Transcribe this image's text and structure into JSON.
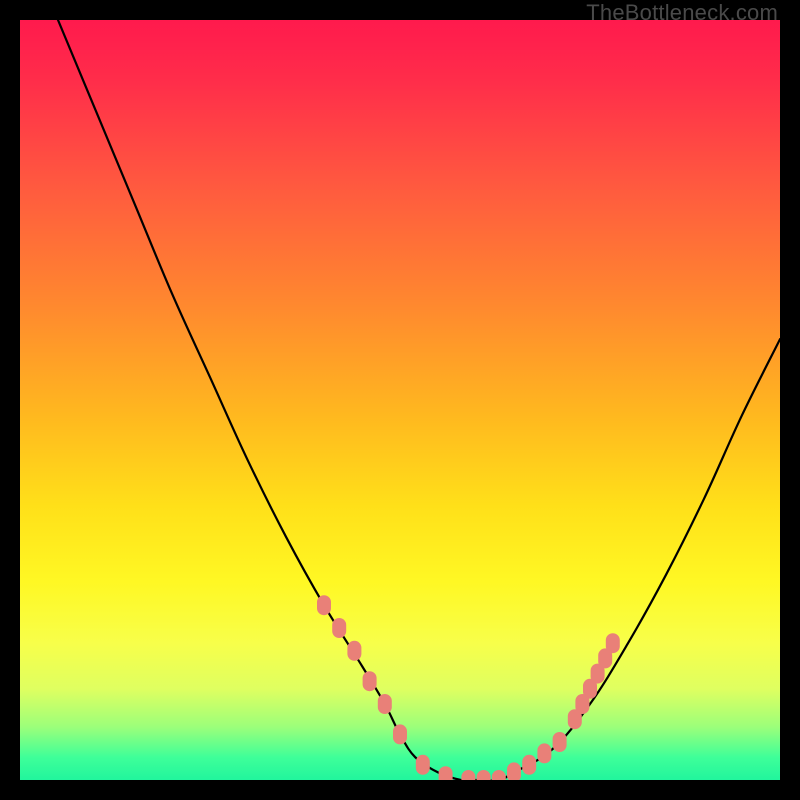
{
  "watermark": "TheBottleneck.com",
  "chart_data": {
    "type": "line",
    "title": "",
    "xlabel": "",
    "ylabel": "",
    "xlim": [
      0,
      100
    ],
    "ylim": [
      0,
      100
    ],
    "series": [
      {
        "name": "bottleneck-curve",
        "x": [
          5,
          10,
          15,
          20,
          25,
          30,
          35,
          40,
          45,
          48,
          50,
          52,
          55,
          58,
          60,
          63,
          65,
          70,
          75,
          80,
          85,
          90,
          95,
          100
        ],
        "values": [
          100,
          88,
          76,
          64,
          53,
          42,
          32,
          23,
          15,
          10,
          6,
          3,
          1,
          0,
          0,
          0,
          1,
          4,
          10,
          18,
          27,
          37,
          48,
          58
        ]
      }
    ],
    "markers": {
      "name": "highlight-points",
      "color": "#e98078",
      "x": [
        40,
        42,
        44,
        46,
        48,
        50,
        53,
        56,
        59,
        61,
        63,
        65,
        67,
        69,
        71,
        73,
        74,
        75,
        76,
        77,
        78
      ],
      "values": [
        23,
        20,
        17,
        13,
        10,
        6,
        2,
        0.5,
        0,
        0,
        0,
        1,
        2,
        3.5,
        5,
        8,
        10,
        12,
        14,
        16,
        18
      ]
    }
  }
}
